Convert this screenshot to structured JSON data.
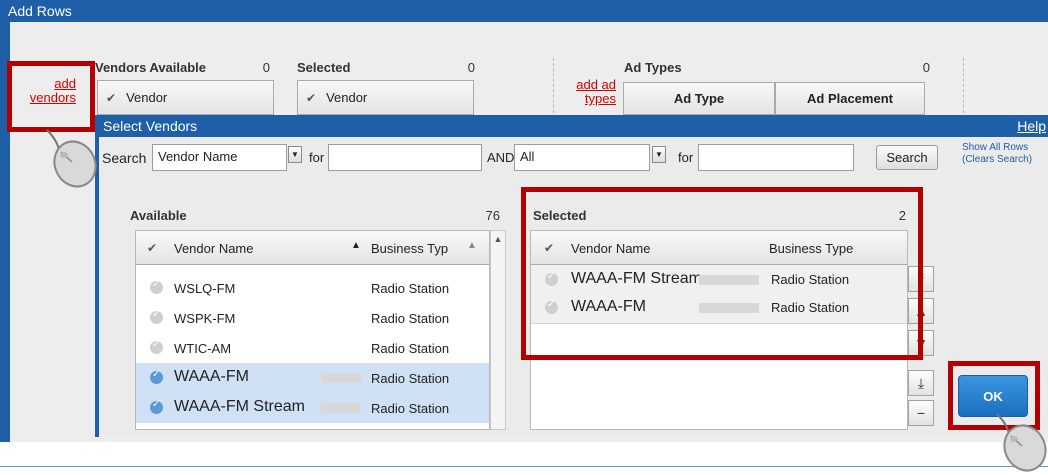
{
  "outer": {
    "title": "Add Rows",
    "vendors_available_label": "Vendors Available",
    "vendors_available_count": "0",
    "selected_label": "Selected",
    "selected_count": "0",
    "vendor_col": "Vendor",
    "selected_vendor_col": "Vendor",
    "add_vendors_link": [
      "add",
      "vendors"
    ],
    "ad_types_label": "Ad Types",
    "ad_types_count": "0",
    "add_ad_types_link": [
      "add ad",
      "types"
    ],
    "ad_type_col": "Ad Type",
    "ad_placement_col": "Ad Placement"
  },
  "dialog": {
    "title": "Select Vendors",
    "help": "Help",
    "search_label": "Search",
    "search_field": "Vendor Name",
    "for_label_1": "for",
    "and_label": "AND",
    "second_field": "All",
    "for_label_2": "for",
    "search_button": "Search",
    "show_all": [
      "Show All Rows",
      "(Clears Search)"
    ]
  },
  "available": {
    "label": "Available",
    "count": "76",
    "col_vendor": "Vendor Name",
    "col_type": "Business Typ",
    "rows": [
      {
        "name": "WSLQ-FM",
        "type": "Radio Station",
        "selected": false
      },
      {
        "name": "WSPK-FM",
        "type": "Radio Station",
        "selected": false
      },
      {
        "name": "WTIC-AM",
        "type": "Radio Station",
        "selected": false
      },
      {
        "name": "WAAA-FM",
        "type": "Radio Station",
        "selected": true
      },
      {
        "name": "WAAA-FM Stream",
        "type": "Radio Station",
        "selected": true
      }
    ]
  },
  "selected": {
    "label": "Selected",
    "count": "2",
    "col_vendor": "Vendor Name",
    "col_type": "Business Type",
    "rows": [
      {
        "name": "WAAA-FM Stream",
        "type": "Radio Station"
      },
      {
        "name": "WAAA-FM",
        "type": "Radio Station"
      }
    ]
  },
  "ok_button": "OK",
  "colors": {
    "title_bar": "#1f5fa8",
    "highlight": "#b30000",
    "link": "#d40000",
    "ok": "#1b6fbf"
  }
}
